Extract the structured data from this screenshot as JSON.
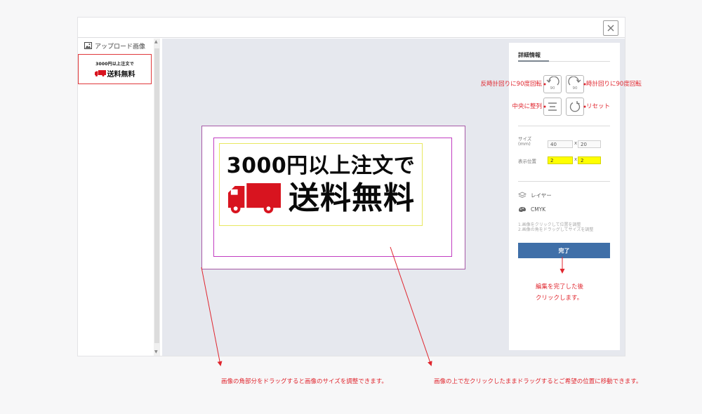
{
  "window": {
    "close_label": "×"
  },
  "left_panel": {
    "header_label": "アップロード画像",
    "thumbnail": {
      "line1": "3000円以上注文で",
      "line2": "送料無料"
    }
  },
  "canvas": {
    "artwork": {
      "line1": "3000円以上注文で",
      "line2": "送料無料"
    }
  },
  "right_panel": {
    "tab_title": "詳細情報",
    "rotate_ccw_value": "90",
    "rotate_cw_value": "90",
    "size_label": "サイズ\n(mm)",
    "size_width": "40",
    "size_height": "20",
    "position_label": "表示位置",
    "position_x": "2",
    "position_y": "2",
    "x_separator": "x",
    "layer_label": "レイヤー",
    "cmyk_label": "CMYK",
    "notes": [
      "1.画像をクリックして位置を調整",
      "2.画像の角をドラッグしてサイズを調整"
    ],
    "done_label": "完了"
  },
  "annotations": {
    "rotate_ccw": "反時計回りに90度回転",
    "rotate_cw": "時計回りに90度回転",
    "center_align": "中央に整列",
    "reset": "リセット",
    "done_hint_1": "編集を完了した後",
    "done_hint_2": "クリックします。",
    "resize_hint": "画像の角部分をドラッグすると画像のサイズを調整できます。",
    "move_hint": "画像の上で左クリックしたままドラッグするとご希望の位置に移動できます。"
  },
  "colors": {
    "accent": "#e0262e",
    "done_button": "#3f6fa8",
    "truck": "#d8141f",
    "trim_line": "#c13dc1",
    "highlight_field": "#ffff00"
  }
}
